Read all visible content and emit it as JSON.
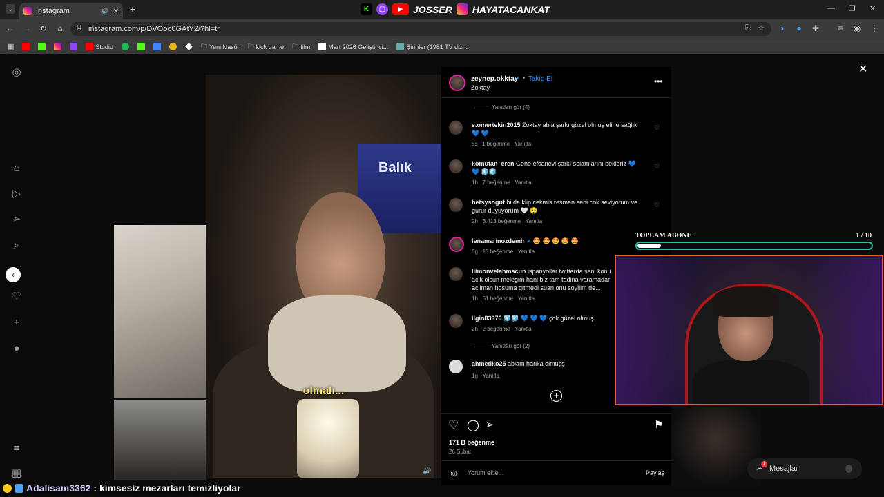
{
  "browser": {
    "tab_title": "Instagram",
    "url": "instagram.com/p/DVOoo0GAtY2/?hl=tr",
    "new_tab_label": "+",
    "bookmarks": [
      "Studio",
      "Yeni klasör",
      "kick game",
      "film",
      "Mart 2026 Geliştirici...",
      "Şirinler (1981 TV diz..."
    ]
  },
  "stream_brand": {
    "name1": "JOSSER",
    "name2": "HAYATACANKAT"
  },
  "post": {
    "username": "zeynep.okktay",
    "follow_label": "Takip Et",
    "subtitle_name": "Zoktay",
    "video_subtitle": "olmalı...",
    "sign_text": "Balık",
    "likes": "171 B beğenme",
    "date": "26 Şubat",
    "comment_placeholder": "Yorum ekle...",
    "share_label": "Paylaş",
    "more_icon": "more-horizontal-icon"
  },
  "comments": [
    {
      "type": "replies",
      "text": "Yanıtları gör (4)"
    },
    {
      "user": "s.omertekin2015",
      "text": "Zoktay abla şarkı güzel olmuş eline sağlık 💙 💙",
      "time": "5s",
      "likes": "1 beğenme",
      "reply": "Yanıtla"
    },
    {
      "user": "komutan_eren",
      "text": "Gene efsanevi şarkı selamlarını bekleriz 💙 💙 🧊🧊",
      "time": "1h",
      "likes": "7 beğenme",
      "reply": "Yanıtla"
    },
    {
      "user": "betsysogut",
      "text": "bi de klip cekmis resmen seni cok seviyorum ve gurur duyuyorum 🤍 🥺",
      "time": "2h",
      "likes": "3.413 beğenme",
      "reply": "Yanıtla"
    },
    {
      "user": "lenamarinozdemir",
      "text": "🤩 🤩 🤩 🤩 🤩",
      "time": "6g",
      "likes": "13 beğenme",
      "reply": "Yanıtla"
    },
    {
      "user": "liimonvelahmacun",
      "text": "ispanyollar twitterda seni konu acik olsun melegim hani biz tam tadina varamadar acilman hosuma gitmedi suan onu soyliim de...",
      "time": "1h",
      "likes": "51 beğenme",
      "reply": "Yanıtla"
    },
    {
      "user": "ilgin83976",
      "text": "🧊🧊 💙 💙 💙 çok güzel olmuş",
      "time": "2h",
      "likes": "2 beğenme",
      "reply": "Yanıtla"
    },
    {
      "type": "replies",
      "text": "Yanıtları gör (2)"
    },
    {
      "user": "ahmetiko25",
      "text": "ablam harika olmuşş",
      "time": "1g",
      "reply": "Yanıtla"
    }
  ],
  "overlay": {
    "sub_label": "TOPLAM ABONE",
    "sub_count": "1  / 10",
    "sub_progress": 0.1
  },
  "chat": {
    "user": "Adalisam3362",
    "message": ": kimsesiz mezarları temizliyolar"
  },
  "messages": {
    "label": "Mesajlar",
    "badge": "1"
  },
  "colors": {
    "accent_blue": "#3897f0",
    "cam_border": "#e0662a",
    "progress_border": "#2bbfa6"
  }
}
